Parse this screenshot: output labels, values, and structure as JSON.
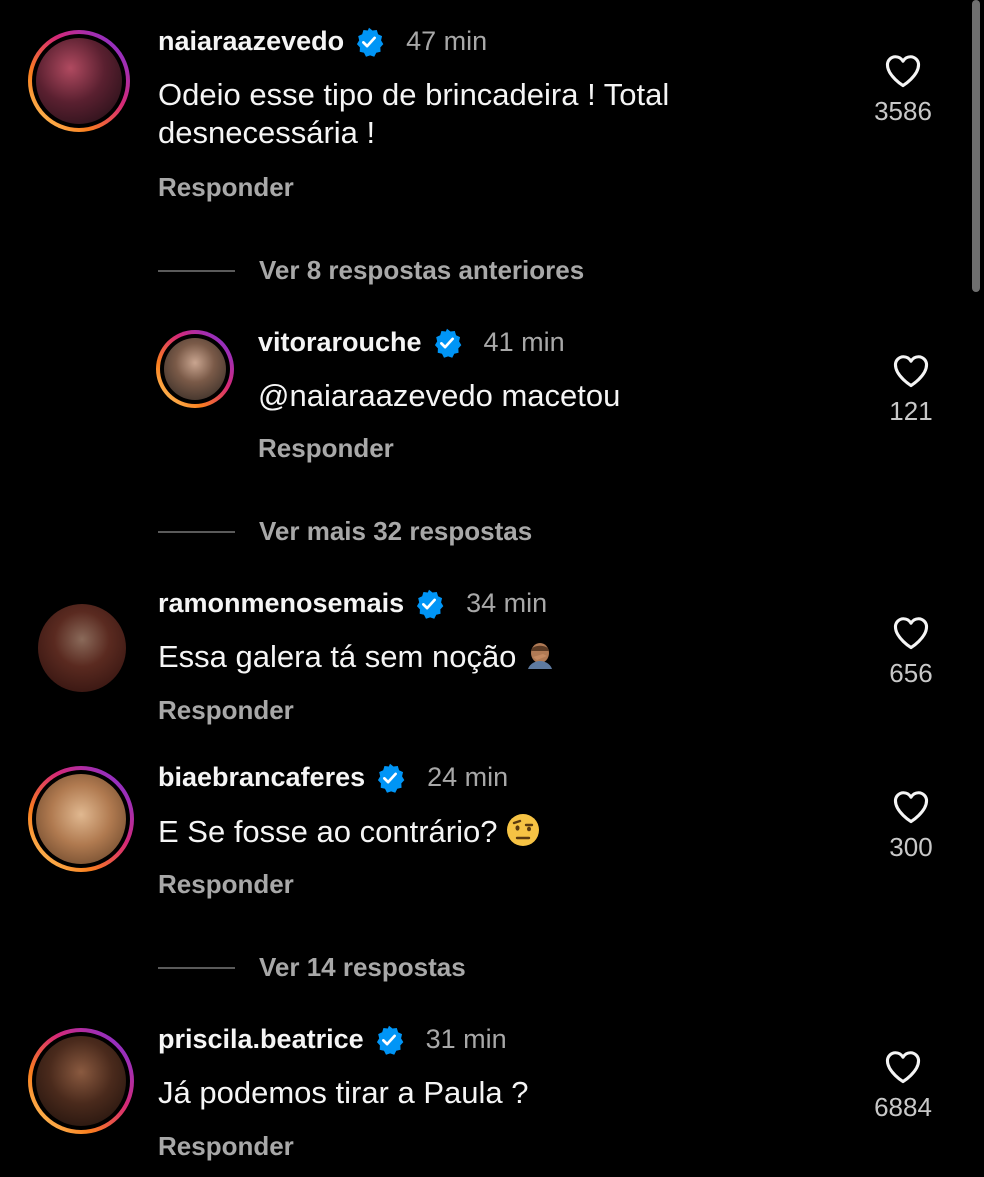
{
  "comments": [
    {
      "username": "naiaraazevedo",
      "time": "47 min",
      "text_line1": "Odeio esse tipo de brincadeira ! Total",
      "text_line2": "desnecessária !",
      "likes": "3586",
      "reply": "Responder"
    },
    {
      "username": "vitorarouche",
      "time": "41 min",
      "text": "@naiaraazevedo macetou",
      "likes": "121",
      "reply": "Responder"
    },
    {
      "username": "ramonmenosemais",
      "time": "34 min",
      "text": "Essa galera tá sem noção",
      "likes": "656",
      "reply": "Responder",
      "emoji": "facepalm-emoji"
    },
    {
      "username": "biaebrancaferes",
      "time": "24 min",
      "text": "E Se fosse ao contrário?",
      "likes": "300",
      "reply": "Responder",
      "emoji": "raised-eyebrow-emoji"
    },
    {
      "username": "priscila.beatrice",
      "time": "31 min",
      "text": "Já podemos tirar a Paula ?",
      "likes": "6884",
      "reply": "Responder"
    }
  ],
  "threads": [
    {
      "label": "Ver 8 respostas anteriores"
    },
    {
      "label": "Ver mais 32 respostas"
    },
    {
      "label": "Ver 14 respostas"
    }
  ],
  "colors": {
    "background": "#000000",
    "verified": "#0095f6",
    "secondary_text": "#a8a8a8"
  }
}
